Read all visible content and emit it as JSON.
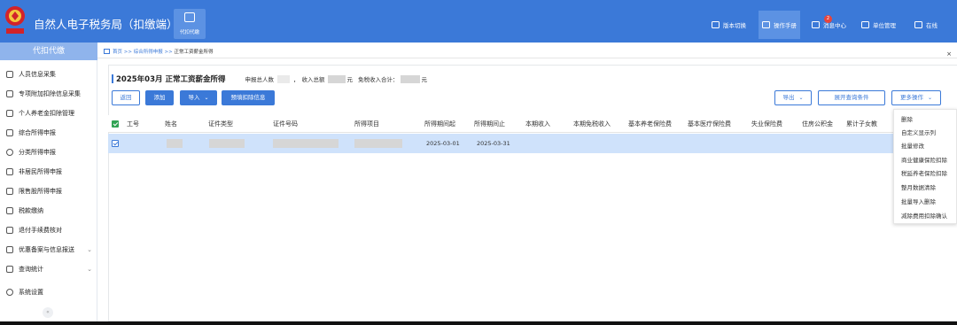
{
  "header": {
    "app_title": "自然人电子税务局（扣缴端）",
    "module_tab": "代扣代缴",
    "nav": [
      {
        "label": "版本切换",
        "icon": "switch-icon"
      },
      {
        "label": "操作手册",
        "icon": "manual-icon"
      },
      {
        "label": "消息中心",
        "icon": "message-icon",
        "badge": "2"
      },
      {
        "label": "单位管理",
        "icon": "building-icon"
      },
      {
        "label": "在线",
        "icon": "online-icon"
      }
    ],
    "active_nav": "操作手册",
    "brand_color": "#3b79d8"
  },
  "sidebar": {
    "header": "代扣代缴",
    "items": [
      {
        "label": "人员信息采集",
        "icon": "person-icon"
      },
      {
        "label": "专项附加扣除信息采集",
        "icon": "doc-icon"
      },
      {
        "label": "个人养老金扣除管理",
        "icon": "wallet-icon"
      },
      {
        "label": "综合所得申报",
        "icon": "report-icon"
      },
      {
        "label": "分类所得申报",
        "icon": "pie-icon"
      },
      {
        "label": "非居民所得申报",
        "icon": "person-icon"
      },
      {
        "label": "限售股所得申报",
        "icon": "chart-icon"
      },
      {
        "label": "税款缴纳",
        "icon": "wallet-icon"
      },
      {
        "label": "退付手续费核对",
        "icon": "doc-icon"
      },
      {
        "label": "优惠备案与信息报送",
        "icon": "doc-icon",
        "expandable": true
      },
      {
        "label": "查询统计",
        "icon": "search-icon",
        "expandable": true
      },
      {
        "label": "系统设置",
        "icon": "gear-icon"
      }
    ]
  },
  "breadcrumb": {
    "items": [
      "首页",
      "综合所得申报",
      "正常工资薪金所得"
    ],
    "separator": ">>"
  },
  "page": {
    "title": "2025年03月 正常工资薪金所得",
    "summary_labels": [
      "申报总人数",
      "收入总额",
      "免税收入合计："
    ],
    "currency_unit": "元"
  },
  "toolbar": {
    "back": "返回",
    "add": "添加",
    "import": "导入",
    "prefill": "预填扣除信息",
    "export": "导出",
    "expand_query": "展开查询条件",
    "more": "更多操作"
  },
  "table": {
    "columns": [
      "工号",
      "姓名",
      "证件类型",
      "证件号码",
      "所得项目",
      "所得期间起",
      "所得期间止",
      "本期收入",
      "本期免税收入",
      "基本养老保险费",
      "基本医疗保险费",
      "失业保险费",
      "住房公积金",
      "累计子女教"
    ],
    "rows": [
      {
        "period_start": "2025-03-01",
        "period_end": "2025-03-31",
        "selected": true
      }
    ]
  },
  "more_menu": {
    "items": [
      "删除",
      "自定义显示列",
      "批量修改",
      "商业健康保险扣除",
      "税延养老保险扣除",
      "整月数据清除",
      "批量导入删除",
      "减除费用扣除确认"
    ]
  }
}
